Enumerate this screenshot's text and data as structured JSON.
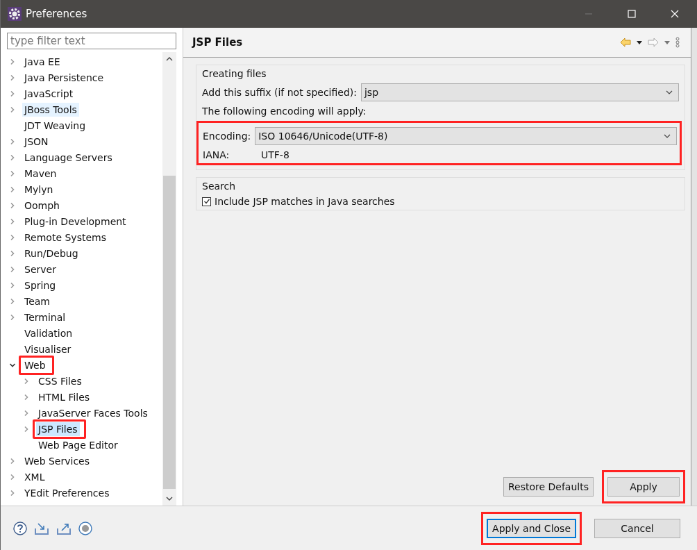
{
  "window": {
    "title": "Preferences"
  },
  "filter": {
    "placeholder": "type filter text"
  },
  "tree": [
    {
      "label": "Java EE",
      "expanded": false,
      "selected": false,
      "hovered": false
    },
    {
      "label": "Java Persistence",
      "expanded": false,
      "selected": false,
      "hovered": false
    },
    {
      "label": "JavaScript",
      "expanded": false,
      "selected": false,
      "hovered": false
    },
    {
      "label": "JBoss Tools",
      "expanded": false,
      "selected": false,
      "hovered": true
    },
    {
      "label": "JDT Weaving",
      "selected": false,
      "hovered": false
    },
    {
      "label": "JSON",
      "expanded": false,
      "selected": false,
      "hovered": false
    },
    {
      "label": "Language Servers",
      "expanded": false,
      "selected": false,
      "hovered": false
    },
    {
      "label": "Maven",
      "expanded": false,
      "selected": false,
      "hovered": false
    },
    {
      "label": "Mylyn",
      "expanded": false,
      "selected": false,
      "hovered": false
    },
    {
      "label": "Oomph",
      "expanded": false,
      "selected": false,
      "hovered": false
    },
    {
      "label": "Plug-in Development",
      "expanded": false,
      "selected": false,
      "hovered": false
    },
    {
      "label": "Remote Systems",
      "expanded": false,
      "selected": false,
      "hovered": false
    },
    {
      "label": "Run/Debug",
      "expanded": false,
      "selected": false,
      "hovered": false
    },
    {
      "label": "Server",
      "expanded": false,
      "selected": false,
      "hovered": false
    },
    {
      "label": "Spring",
      "expanded": false,
      "selected": false,
      "hovered": false
    },
    {
      "label": "Team",
      "expanded": false,
      "selected": false,
      "hovered": false
    },
    {
      "label": "Terminal",
      "expanded": false,
      "selected": false,
      "hovered": false
    },
    {
      "label": "Validation",
      "selected": false,
      "hovered": false
    },
    {
      "label": "Visualiser",
      "selected": false,
      "hovered": false
    },
    {
      "label": "Web",
      "expanded": true,
      "selected": false,
      "hovered": false,
      "annotated": true,
      "children": [
        {
          "label": "CSS Files",
          "expanded": false,
          "selected": false,
          "hovered": false
        },
        {
          "label": "HTML Files",
          "expanded": false,
          "selected": false,
          "hovered": false
        },
        {
          "label": "JavaServer Faces Tools",
          "expanded": false,
          "selected": false,
          "hovered": false
        },
        {
          "label": "JSP Files",
          "expanded": false,
          "selected": true,
          "hovered": false,
          "annotated": true
        },
        {
          "label": "Web Page Editor",
          "selected": false,
          "hovered": false
        }
      ]
    },
    {
      "label": "Web Services",
      "expanded": false,
      "selected": false,
      "hovered": false
    },
    {
      "label": "XML",
      "expanded": false,
      "selected": false,
      "hovered": false
    },
    {
      "label": "YEdit Preferences",
      "expanded": false,
      "selected": false,
      "hovered": false
    }
  ],
  "page": {
    "title": "JSP Files",
    "creating": {
      "legend": "Creating files",
      "suffix_label": "Add this suffix (if not specified):",
      "suffix_value": "jsp",
      "encoding_note": "The following encoding will apply:",
      "encoding_group": {
        "annotated": true,
        "encoding_label": "Encoding:",
        "encoding_value": "ISO 10646/Unicode(UTF-8)",
        "iana_label": "IANA:",
        "iana_value": "UTF-8"
      }
    },
    "search": {
      "legend": "Search",
      "option": {
        "label": "Include JSP matches in Java searches",
        "checked": true
      }
    },
    "restore_button": {
      "label": "Restore Defaults"
    },
    "apply_button": {
      "label": "Apply",
      "annotated": true
    }
  },
  "buttons": [
    {
      "label": "Apply and Close",
      "default": true,
      "annotated": true
    },
    {
      "label": "Cancel",
      "default": false
    }
  ]
}
